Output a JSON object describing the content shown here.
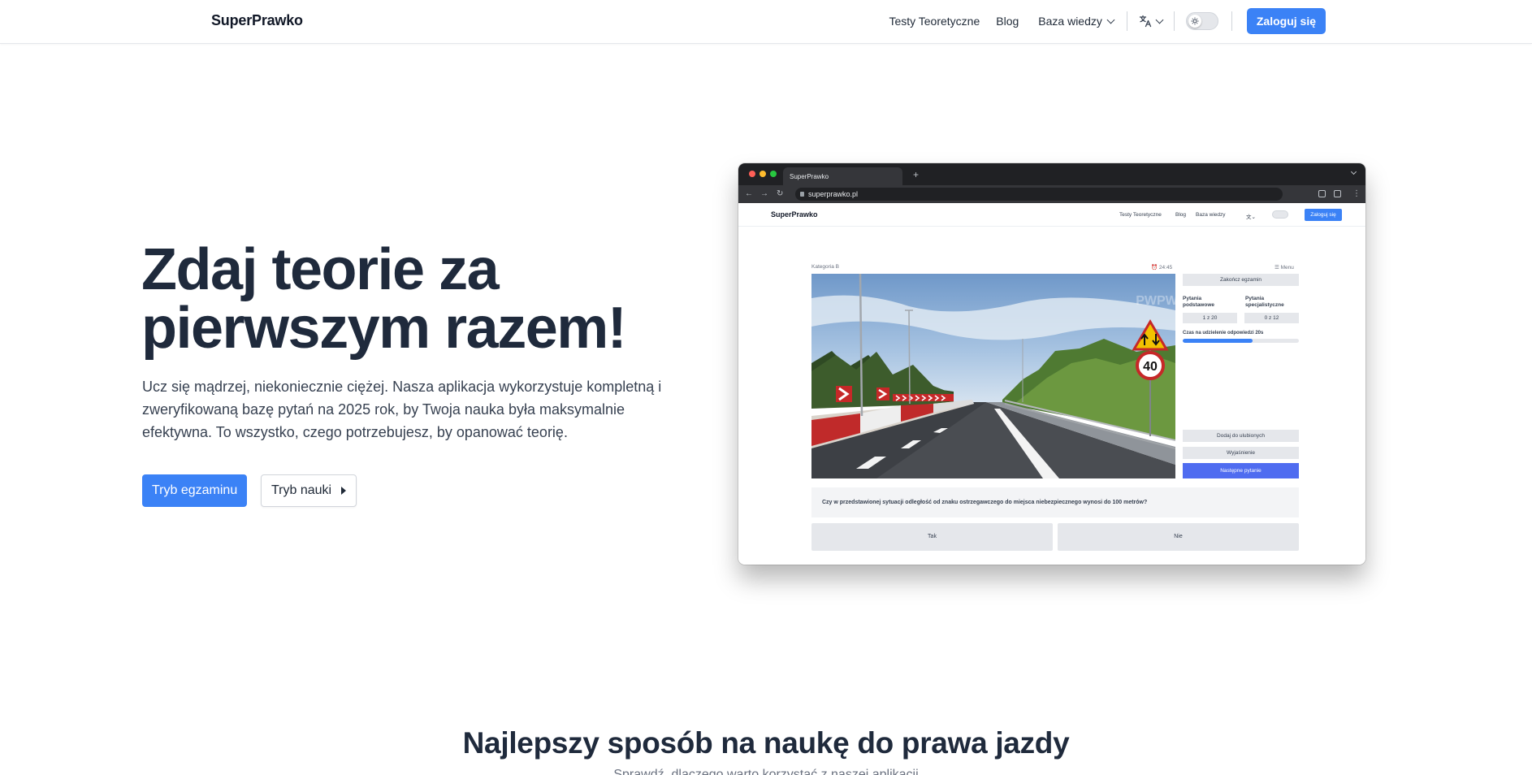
{
  "navbar": {
    "brand": "SuperPrawko",
    "links": [
      "Testy Teoretyczne",
      "Blog",
      "Baza wiedzy"
    ],
    "login": "Zaloguj się"
  },
  "hero": {
    "title": "Zdaj teorie za pierwszym razem!",
    "description": "Ucz się mądrzej, niekoniecznie ciężej. Nasza aplikacja wykorzystuje kompletną i zweryfikowaną bazę pytań na 2025 rok, by Twoja nauka była maksymalnie efektywna. To wszystko, czego potrzebujesz, by opanować teorię.",
    "btn_exam": "Tryb egzaminu",
    "btn_learn": "Tryb nauki"
  },
  "mock": {
    "tab_title": "SuperPrawko",
    "url": "superprawko.pl",
    "brand": "SuperPrawko",
    "links": [
      "Testy Teoretyczne",
      "Blog",
      "Baza wiedzy"
    ],
    "login": "Zaloguj się",
    "category": "Kategoria B",
    "timer": "24:45",
    "menu": "Menu",
    "end_exam": "Zakończ egzamin",
    "basic_label": "Pytania podstawowe",
    "basic_count": "1 z 20",
    "special_label": "Pytania specjalistyczne",
    "special_count": "0 z 12",
    "time_label": "Czas na udzielenie odpowiedzi 20s",
    "time_progress": 0.6,
    "watermark": "PWPW",
    "sign_speed": "40",
    "add_favorite": "Dodaj do ulubionych",
    "explanation": "Wyjaśnienie",
    "next_question": "Następne pytanie",
    "question": "Czy w przedstawionej sytuacji odległość od znaku ostrzegawczego do miejsca niebezpiecznego wynosi do 100 metrów?",
    "answer_yes": "Tak",
    "answer_no": "Nie"
  },
  "section": {
    "title": "Najlepszy sposób na naukę do prawa jazdy",
    "subtitle": "Sprawdź, dlaczego warto korzystać z naszej aplikacji"
  },
  "colors": {
    "primary": "#3b82f6",
    "heading": "#1f2a3c",
    "text": "#374151"
  }
}
